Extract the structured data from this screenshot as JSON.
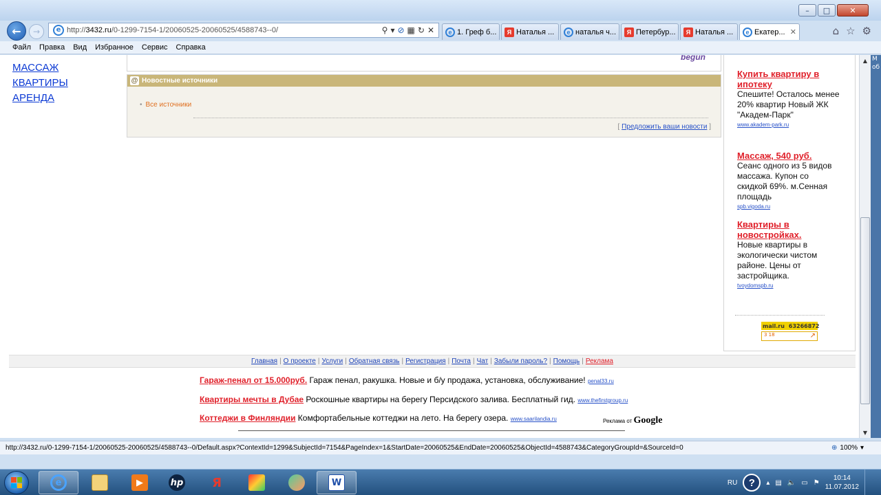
{
  "browser": {
    "address": {
      "prefix": "http://",
      "host": "3432.ru",
      "path": "/0-1299-7154-1/20060525-20060525/4588743--0/"
    },
    "tabs": [
      {
        "label": "1. Греф б...",
        "icon": "ie"
      },
      {
        "label": "Наталья ...",
        "icon": "yandex"
      },
      {
        "label": "наталья ч...",
        "icon": "ie"
      },
      {
        "label": "Петербур...",
        "icon": "yandex"
      },
      {
        "label": "Наталья ...",
        "icon": "yandex"
      },
      {
        "label": "Екатер...",
        "icon": "ie",
        "active": true
      }
    ],
    "menu": [
      "Файл",
      "Правка",
      "Вид",
      "Избранное",
      "Сервис",
      "Справка"
    ]
  },
  "page": {
    "left_links": [
      "МАССАЖ",
      "КВАРТИРЫ",
      "АРЕНДА"
    ],
    "begun_logo": "begun",
    "news": {
      "header": "Новостные источники",
      "all_sources": "Все источники",
      "suggest_open": "[",
      "suggest_link": "Предложить ваши новости",
      "suggest_close": "]"
    },
    "ads": [
      {
        "title": "Купить квартиру в ипотеку",
        "text": "Спешите! Осталось менее 20% квартир Новый ЖК \"Академ-Парк\"",
        "site": "www.akadem-park.ru"
      },
      {
        "title": "Массаж, 540 руб.",
        "text": "Сеанс одного из 5 видов массажа. Купон со скидкой 69%. м.Сенная площадь",
        "site": "spb.vigoda.ru"
      },
      {
        "title": "Квартиры в новостройках.",
        "text": "Новые квартиры в экологически чистом районе. Цены от застройщика.",
        "site": "tvoydomspb.ru"
      }
    ],
    "counter": {
      "brand": "mail.ru",
      "number": "63266872",
      "sub": "3 18"
    },
    "footer_nav": [
      "Главная",
      "О проекте",
      "Услуги",
      "Обратная связь",
      "Регистрация",
      "Почта",
      "Чат",
      "Забыли пароль?",
      "Помощь",
      "Реклама"
    ],
    "google_ads": [
      {
        "title": "Гараж-пенал от 15.000руб.",
        "text": "Гараж пенал, ракушка. Новые и б/у продажа, установка, обслуживание!",
        "site": "penal33.ru"
      },
      {
        "title": "Квартиры мечты в Дубае",
        "text": "Роскошные квартиры на берегу Персидского залива. Бесплатный гид.",
        "site": "www.thefirstgroup.ru"
      },
      {
        "title": "Коттеджи в Финляндии",
        "text": "Комфортабельные коттеджи на лето. На берегу озера.",
        "site": "www.saarilandia.ru"
      }
    ],
    "google_label": "Реклама от",
    "google_word": "Google"
  },
  "status": {
    "url": "http://3432.ru/0-1299-7154-1/20060525-20060525/4588743--0/Default.aspx?ContextId=1299&SubjectId=7154&PageIndex=1&StartDate=20060525&EndDate=20060525&ObjectId=4588743&CategoryGroupId=&SourceId=0",
    "zoom": "100%"
  },
  "taskbar": {
    "lang": "RU",
    "time": "10:14",
    "date": "11.07.2012"
  },
  "right_strip_text": "М\nоб",
  "colors": {
    "link_blue": "#0c3ad4",
    "ad_red": "#e0202a",
    "news_header": "#c9b679"
  }
}
